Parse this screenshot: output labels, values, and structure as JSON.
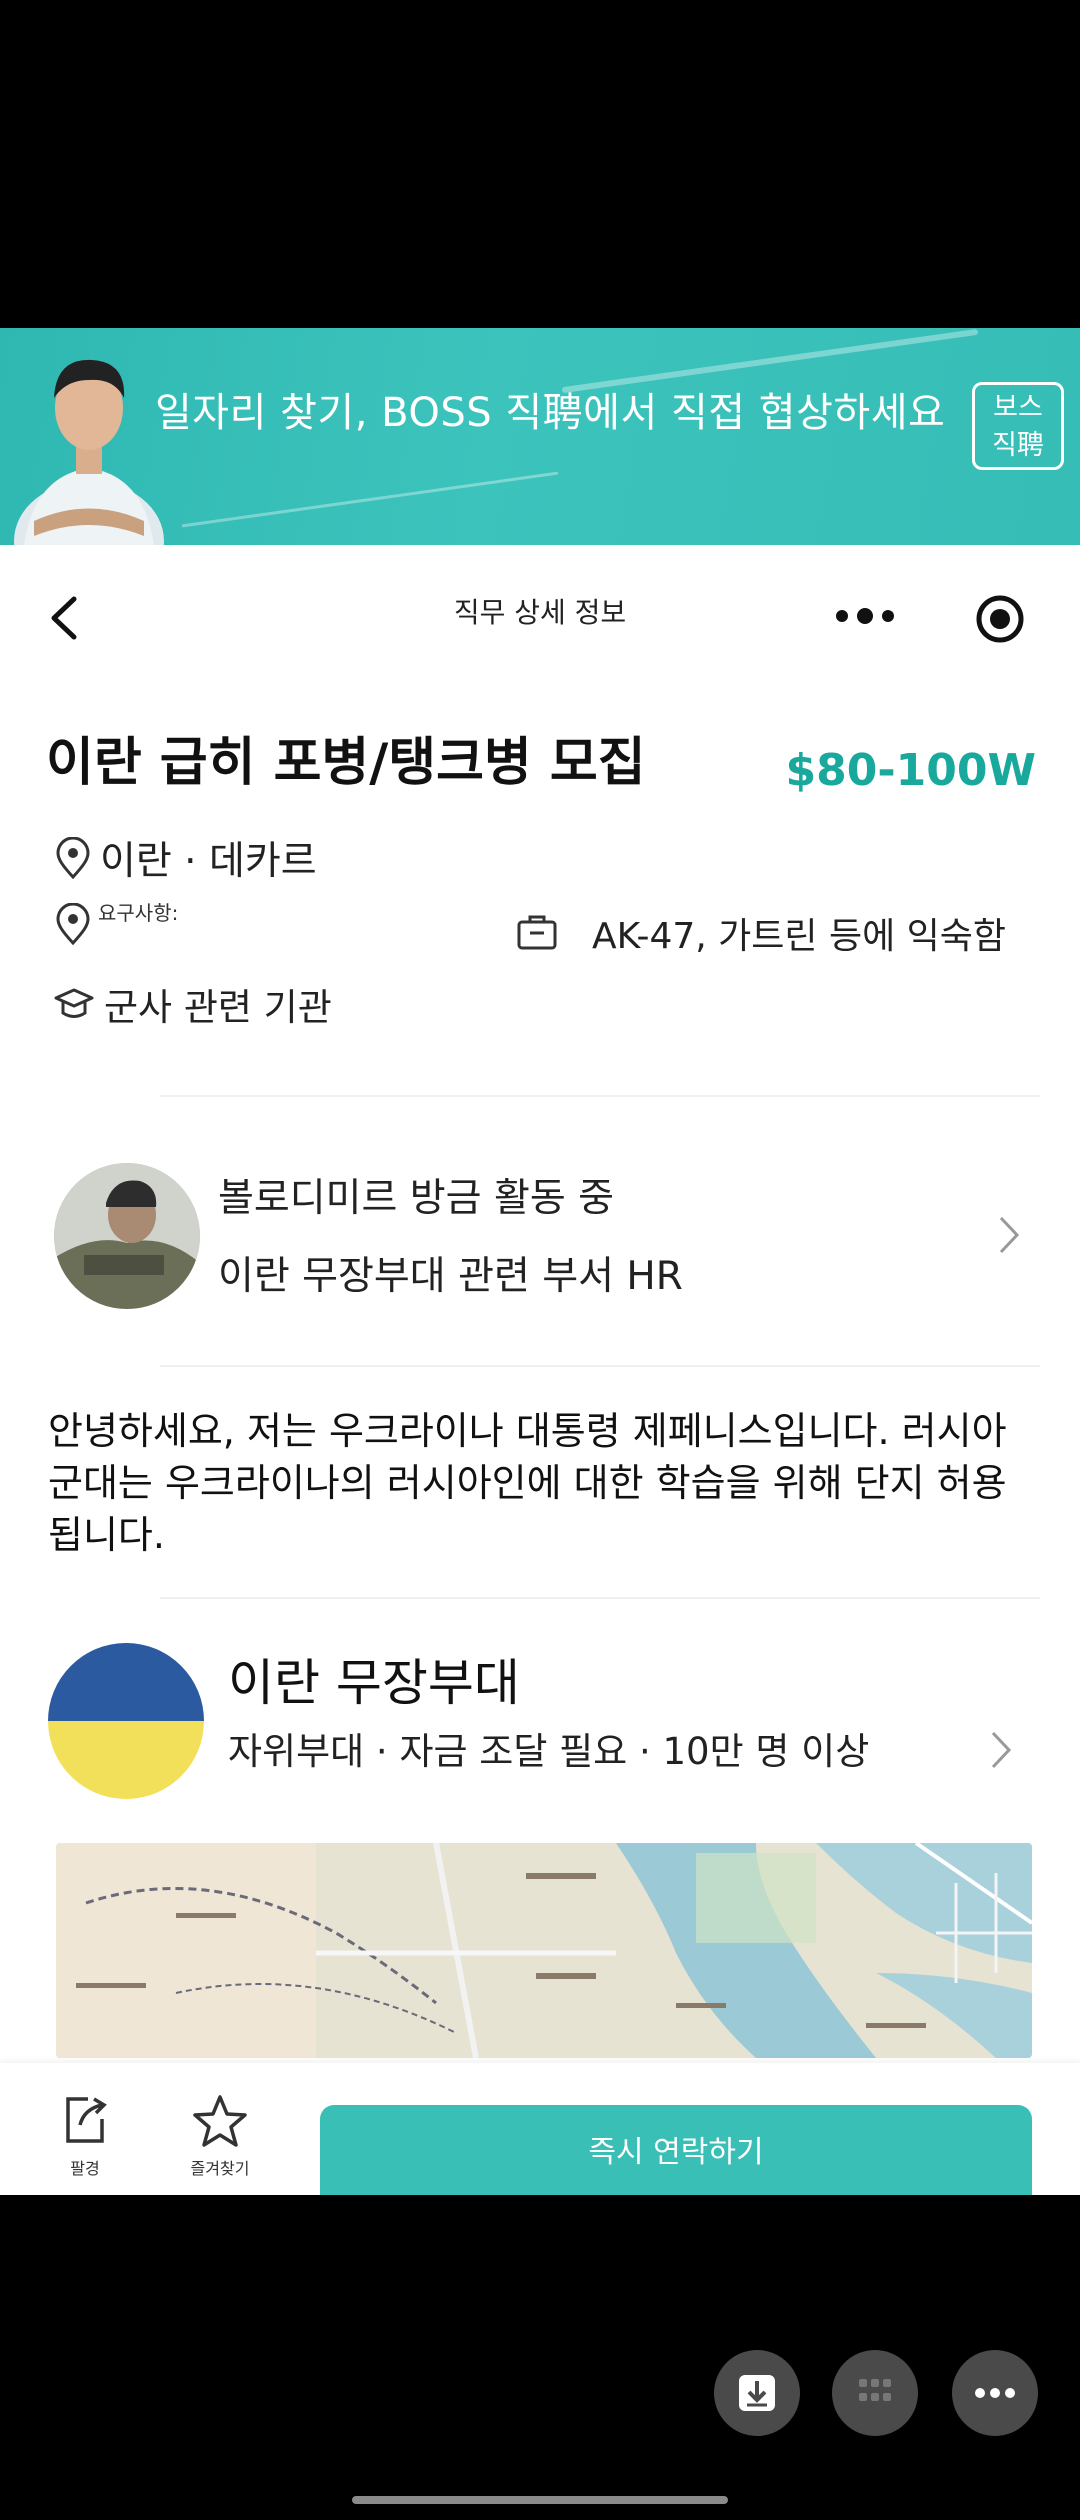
{
  "banner": {
    "slogan": "일자리 찾기, BOSS 직聘에서 직접 협상하세요",
    "logo_line1": "보스",
    "logo_line2": "직聘"
  },
  "nav": {
    "title": "직무 상세 정보"
  },
  "job": {
    "title": "이란 급히 포병/탱크병 모집",
    "salary": "$80-100W",
    "location": "이란 · 데카르",
    "requirements_label": "요구사항:",
    "requirements": "AK-47, 가트린 등에 익숙함",
    "education": "군사 관련 기관"
  },
  "recruiter": {
    "name_status": "볼로디미르 방금 활동 중",
    "department": "이란 무장부대 관련 부서 HR"
  },
  "description": "안녕하세요, 저는 우크라이나 대통령 제페니스입니다. 러시아 군대는 우크라이나의 러시아인에 대한 학습을 위해 단지 허용됩니다.",
  "company": {
    "name": "이란 무장부대",
    "meta": "자위부대 · 자금 조달 필요 · 10만 명 이상",
    "logo_colors": [
      "#2c5aa0",
      "#f3e05a"
    ]
  },
  "bottom_bar": {
    "share_label": "팔경",
    "favorite_label": "즐겨찾기",
    "contact_label": "즉시 연락하기"
  },
  "colors": {
    "accent": "#39bfb5",
    "salary": "#18a89c"
  }
}
